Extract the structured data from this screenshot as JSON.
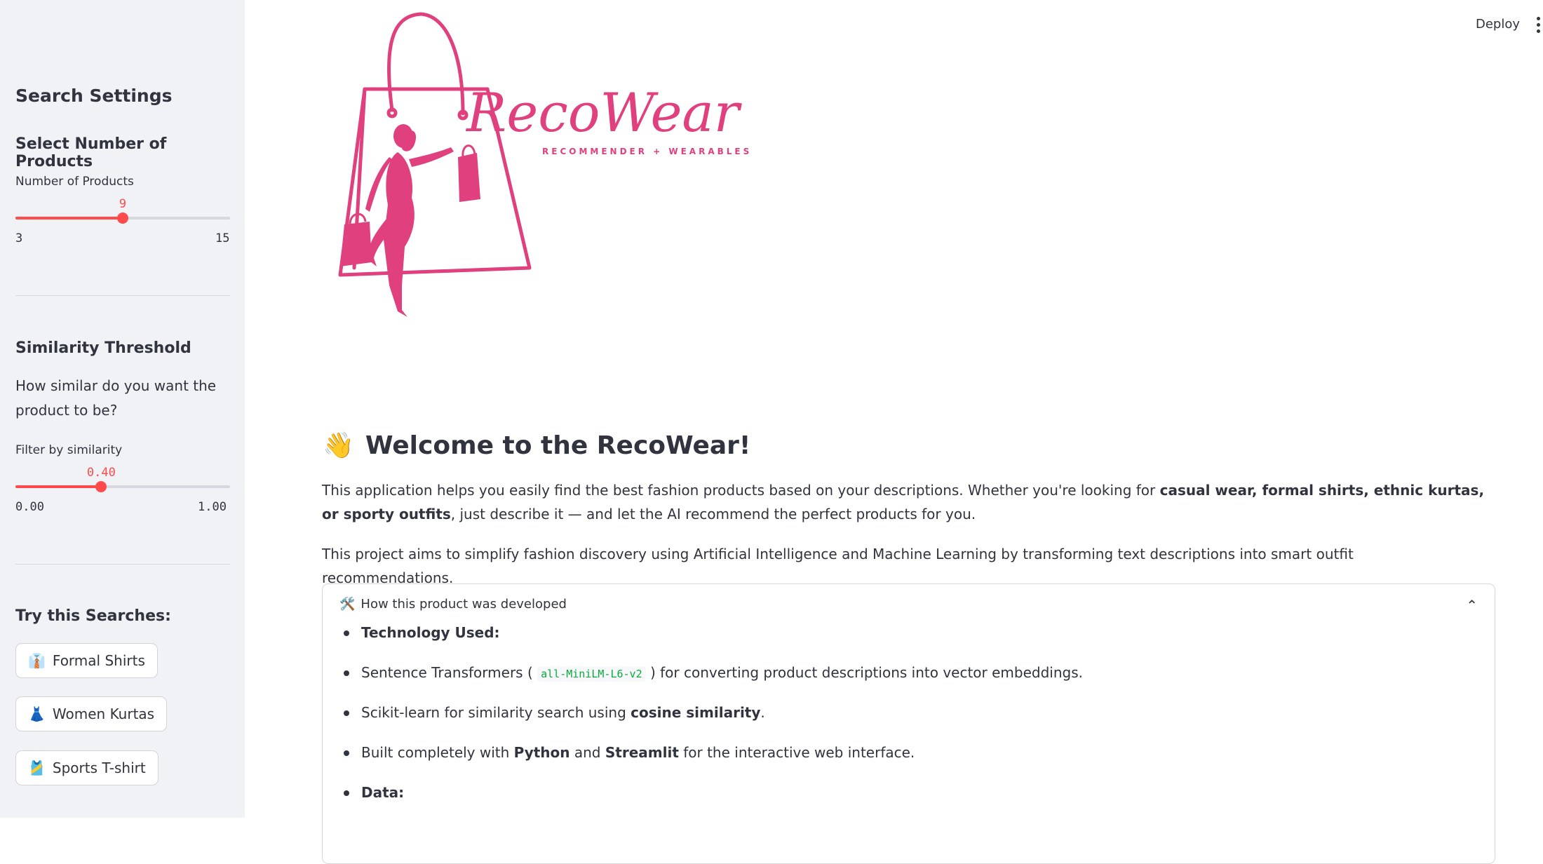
{
  "topbar": {
    "deploy_label": "Deploy",
    "menu_icon": "kebab-menu-icon"
  },
  "logo": {
    "brand": "RecoWear",
    "tagline": "RECOMMENDER + WEARABLES",
    "color": "#e0407e"
  },
  "sidebar": {
    "title": "Search Settings",
    "products_section": {
      "heading": "Select Number of Products",
      "slider_label": "Number of Products",
      "value": "9",
      "min": "3",
      "max": "15",
      "fraction": 0.5
    },
    "similarity_section": {
      "heading": "Similarity Threshold",
      "description": "How similar do you want the product to be?",
      "slider_label": "Filter by similarity",
      "value": "0.40",
      "min": "0.00",
      "max": "1.00",
      "fraction": 0.4
    },
    "searches": {
      "heading": "Try this Searches:",
      "items": [
        {
          "emoji": "👔",
          "label": "Formal Shirts"
        },
        {
          "emoji": "👗",
          "label": "Women Kurtas"
        },
        {
          "emoji": "🎽",
          "label": "Sports T-shirt"
        }
      ]
    }
  },
  "main": {
    "welcome_emoji": "👋",
    "welcome_title": "Welcome to the RecoWear!",
    "intro_1": "This application helps you easily find the best fashion products based on your descriptions. Whether you're looking for",
    "intro_bold": "casual wear, formal shirts, ethnic kurtas, or sporty outfits",
    "intro_2": ", just describe it — and let the AI recommend the perfect products for you.",
    "intro_para2": "This project aims to simplify fashion discovery using Artificial Intelligence and Machine Learning by transforming text descriptions into smart outfit recommendations.",
    "expander": {
      "icon": "🛠️",
      "title": "How this product was developed",
      "tech_heading": "Technology Used:",
      "item1_pre": "Sentence Transformers (",
      "item1_code": "all-MiniLM-L6-v2",
      "item1_post": ") for converting product descriptions into vector embeddings.",
      "item2_pre": "Scikit-learn for similarity search using",
      "item2_bold": "cosine similarity",
      "item2_post": ".",
      "item3_pre": "Built completely with",
      "item3_b1": "Python",
      "item3_mid": "and",
      "item3_b2": "Streamlit",
      "item3_post": "for the interactive web interface.",
      "data_heading": "Data:"
    }
  },
  "colors": {
    "accent": "#ff4b4b",
    "sidebar_bg": "#f0f2f6",
    "text": "#31333f"
  }
}
